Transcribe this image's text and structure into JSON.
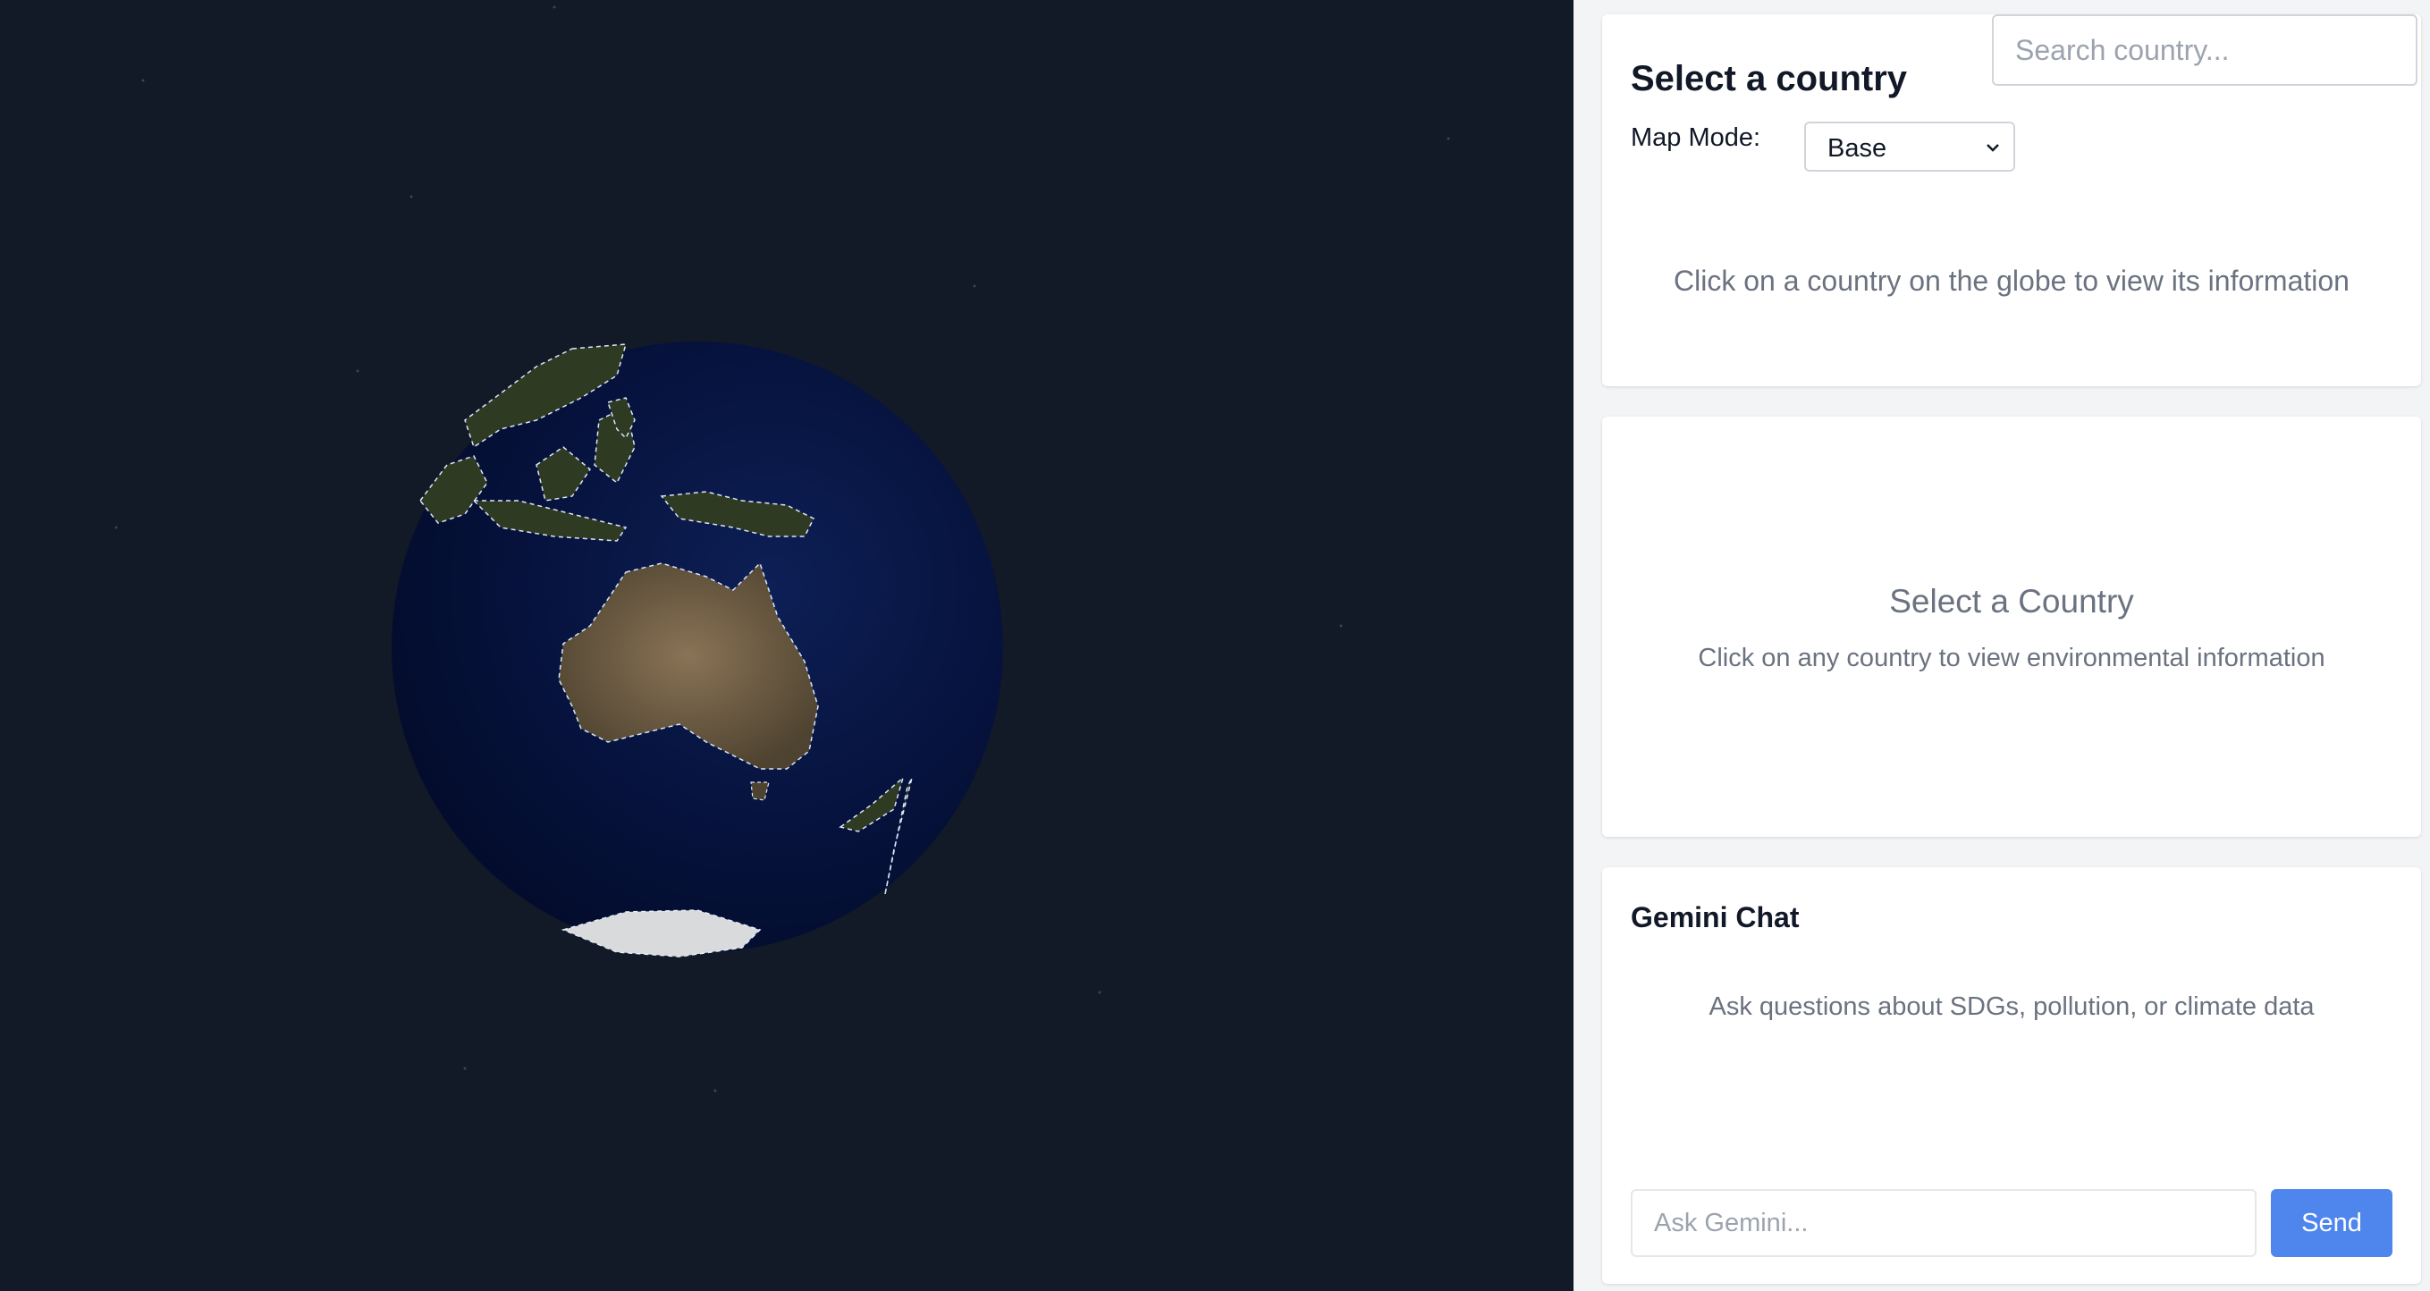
{
  "globe": {
    "description_icon": "earth-globe-icon"
  },
  "country_panel": {
    "title": "Select a country",
    "search_placeholder": "Search country...",
    "map_mode_label": "Map Mode:",
    "map_mode_value": "Base",
    "hint": "Click on a country on the globe to view its information"
  },
  "environment_panel": {
    "title": "Select a Country",
    "hint": "Click on any country to view environmental information"
  },
  "chat_panel": {
    "title": "Gemini Chat",
    "hint": "Ask questions about SDGs, pollution, or climate data",
    "input_placeholder": "Ask Gemini...",
    "send_label": "Send",
    "send_color": "#4f86ee"
  }
}
